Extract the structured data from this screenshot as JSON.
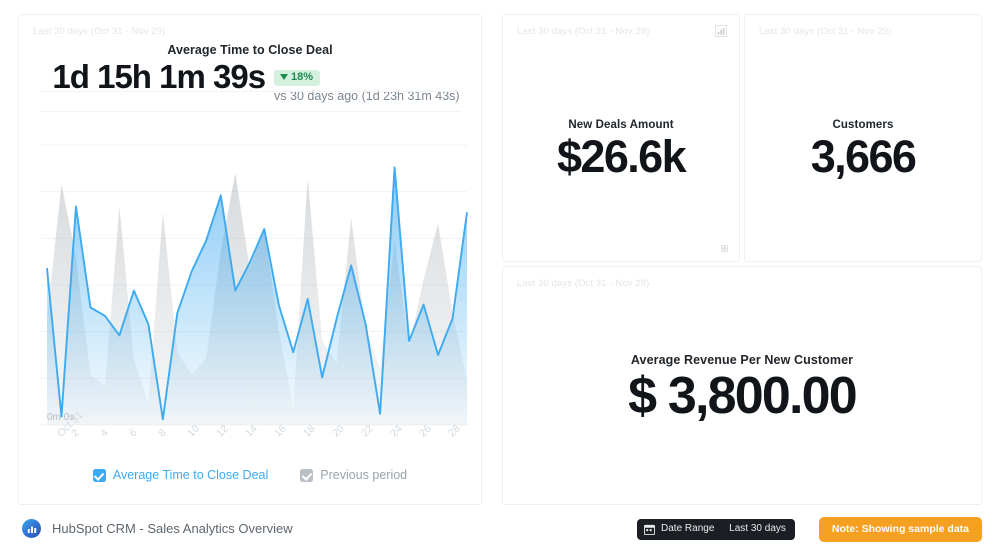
{
  "theme": {
    "accent_blue": "#3eaaf0",
    "previous_gray": "#cfd3d7",
    "positive_green": "#1f8a4d",
    "badge_green_bg": "#d6f0e0",
    "note_orange": "#f5a020",
    "card_border": "#eef0f2"
  },
  "date_range_label": "Last 30 days (Oct 31 - Nov 29)",
  "main_card": {
    "date_range": "Last 30 days (Oct 31 - Nov 29)",
    "title": "Average Time to Close Deal",
    "value": "1d 15h 1m 39s",
    "delta_badge": "18%",
    "delta_direction": "down",
    "comparison": "vs 30 days ago (1d 23h 31m 43s)",
    "y_zero_label": "0m 0s",
    "legend": [
      {
        "label": "Average Time to Close Deal",
        "checked": true,
        "color": "blue"
      },
      {
        "label": "Previous period",
        "checked": true,
        "color": "gray"
      }
    ]
  },
  "new_deals_card": {
    "date_range": "Last 30 days (Oct 31 - Nov 29)",
    "title": "New Deals Amount",
    "value": "$26.6k",
    "top_icon": "bar-chart-icon",
    "corner_icon": "resize-grip-icon"
  },
  "customers_card": {
    "date_range": "Last 30 days (Oct 31 - Nov 29)",
    "title": "Customers",
    "value": "3,666"
  },
  "arpc_card": {
    "date_range": "Last 30 days (Oct 31 - Nov 29)",
    "title": "Average Revenue Per New Customer",
    "value": "$ 3,800.00"
  },
  "footer": {
    "brand": "HubSpot CRM - Sales Analytics Overview",
    "brand_icon": "hubspot-chart-icon",
    "date_badge_icon": "calendar-icon",
    "date_badge_label": "Date Range",
    "date_badge_value": "Last 30 days",
    "note_badge": "Note: Showing sample data"
  },
  "chart_data": {
    "type": "area",
    "title": "Average Time to Close Deal",
    "xlabel": "",
    "ylabel": "",
    "grid": true,
    "legend_position": "bottom",
    "ylim": [
      0,
      100
    ],
    "y_tick_labels": [
      "0m 0s"
    ],
    "categories": [
      "Oct 31",
      "1",
      "2",
      "3",
      "4",
      "5",
      "6",
      "7",
      "8",
      "9",
      "10",
      "11",
      "12",
      "13",
      "14",
      "15",
      "16",
      "17",
      "18",
      "19",
      "20",
      "21",
      "22",
      "23",
      "24",
      "25",
      "26",
      "27",
      "28",
      "29"
    ],
    "x_tick_labels": [
      "Oct 31",
      "2",
      "4",
      "6",
      "8",
      "10",
      "12",
      "14",
      "16",
      "18",
      "20",
      "22",
      "24",
      "26",
      "28"
    ],
    "series": [
      {
        "name": "Average Time to Close Deal",
        "color": "#3eaaf0",
        "values": [
          56,
          3,
          78,
          42,
          39,
          32,
          48,
          36,
          2,
          40,
          55,
          66,
          82,
          48,
          58,
          70,
          43,
          26,
          45,
          17,
          38,
          57,
          36,
          4,
          92,
          30,
          43,
          25,
          38,
          76
        ]
      },
      {
        "name": "Previous period",
        "color": "#cfd3d7",
        "values": [
          38,
          86,
          60,
          18,
          14,
          78,
          23,
          8,
          76,
          26,
          18,
          24,
          62,
          90,
          56,
          70,
          34,
          6,
          88,
          30,
          22,
          74,
          34,
          20,
          66,
          28,
          52,
          72,
          40,
          16
        ]
      }
    ]
  }
}
